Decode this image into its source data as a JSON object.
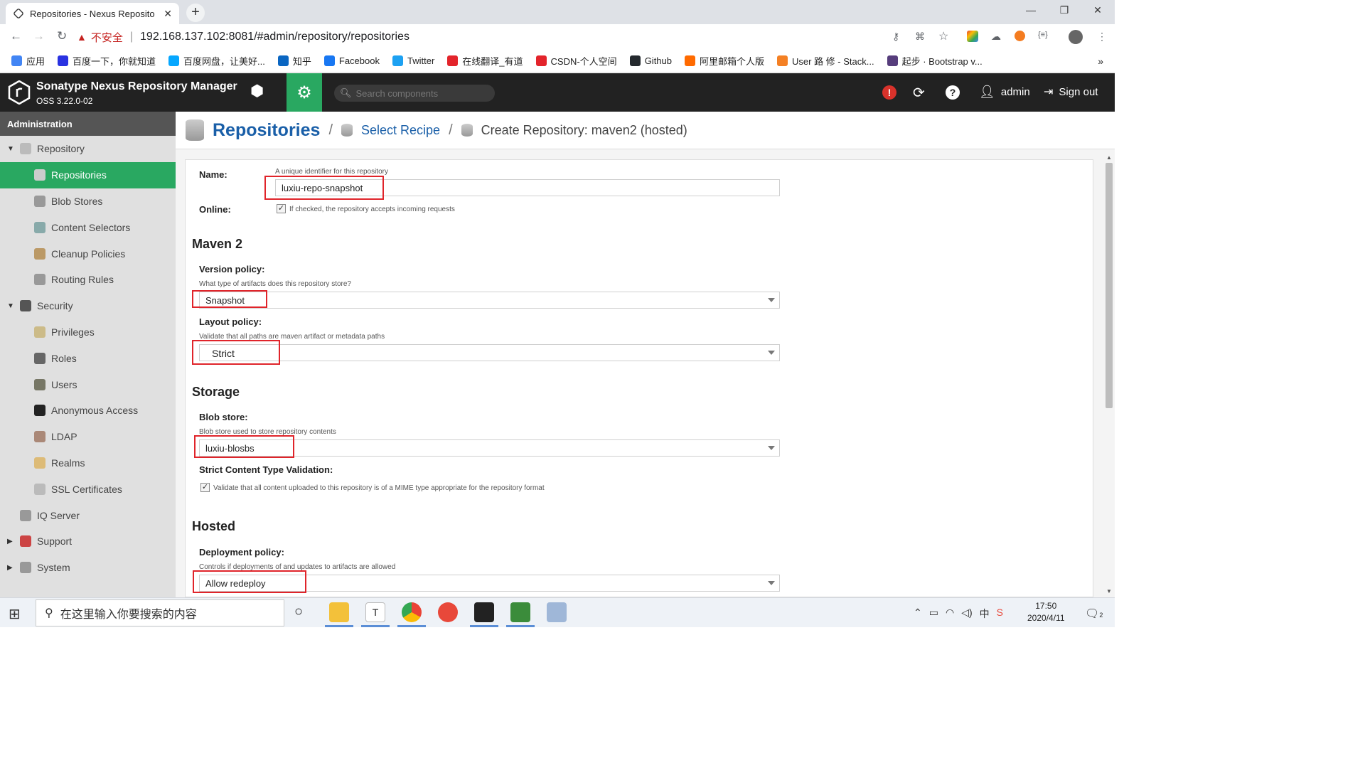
{
  "browser": {
    "tab_title": "Repositories - Nexus Reposito",
    "insecure_label": "不安全",
    "url": "192.168.137.102:8081/#admin/repository/repositories"
  },
  "bookmarks": [
    {
      "label": "应用",
      "color": "#4285f4"
    },
    {
      "label": "百度一下，你就知道",
      "color": "#2932e1"
    },
    {
      "label": "百度网盘，让美好...",
      "color": "#06a7ff"
    },
    {
      "label": "知乎",
      "color": "#0a66c2"
    },
    {
      "label": "Facebook",
      "color": "#1877f2"
    },
    {
      "label": "Twitter",
      "color": "#1da1f2"
    },
    {
      "label": "在线翻译_有道",
      "color": "#e3242b"
    },
    {
      "label": "CSDN-个人空间",
      "color": "#e3242b"
    },
    {
      "label": "Github",
      "color": "#24292e"
    },
    {
      "label": "阿里邮箱个人版",
      "color": "#ff6a00"
    },
    {
      "label": "User 路 修 - Stack...",
      "color": "#f48024"
    },
    {
      "label": "起步 · Bootstrap v...",
      "color": "#563d7c"
    }
  ],
  "header": {
    "app_name": "Sonatype Nexus Repository Manager",
    "version": "OSS 3.22.0-02",
    "search_placeholder": "Search components",
    "user": "admin",
    "signout": "Sign out",
    "alert_mark": "!"
  },
  "sidebar": {
    "title": "Administration",
    "items": [
      {
        "label": "Repository",
        "level": 0,
        "expand": "▼",
        "icon_color": "#bbb"
      },
      {
        "label": "Repositories",
        "level": 1,
        "selected": true,
        "icon_color": "#ccc"
      },
      {
        "label": "Blob Stores",
        "level": 1,
        "icon_color": "#999"
      },
      {
        "label": "Content Selectors",
        "level": 1,
        "icon_color": "#8aa"
      },
      {
        "label": "Cleanup Policies",
        "level": 1,
        "icon_color": "#b96"
      },
      {
        "label": "Routing Rules",
        "level": 1,
        "icon_color": "#999"
      },
      {
        "label": "Security",
        "level": 0,
        "expand": "▼",
        "icon_color": "#555"
      },
      {
        "label": "Privileges",
        "level": 1,
        "icon_color": "#cb8"
      },
      {
        "label": "Roles",
        "level": 1,
        "icon_color": "#666"
      },
      {
        "label": "Users",
        "level": 1,
        "icon_color": "#776"
      },
      {
        "label": "Anonymous Access",
        "level": 1,
        "icon_color": "#222"
      },
      {
        "label": "LDAP",
        "level": 1,
        "icon_color": "#a87"
      },
      {
        "label": "Realms",
        "level": 1,
        "icon_color": "#db7"
      },
      {
        "label": "SSL Certificates",
        "level": 1,
        "icon_color": "#bbb"
      },
      {
        "label": "IQ Server",
        "level": 0,
        "expand": "",
        "icon_color": "#999"
      },
      {
        "label": "Support",
        "level": 0,
        "expand": "▶",
        "icon_color": "#c44"
      },
      {
        "label": "System",
        "level": 0,
        "expand": "▶",
        "icon_color": "#999"
      }
    ]
  },
  "breadcrumb": {
    "main": "Repositories",
    "recipe": "Select Recipe",
    "create": "Create Repository: maven2 (hosted)",
    "separator": "/"
  },
  "form": {
    "name_label": "Name:",
    "name_hint": "A unique identifier for this repository",
    "name_value": "luxiu-repo-snapshot",
    "online_label": "Online:",
    "online_hint": "If checked, the repository accepts incoming requests",
    "maven_section": "Maven 2",
    "version_label": "Version policy:",
    "version_hint": "What type of artifacts does this repository store?",
    "version_value": "Snapshot",
    "layout_label": "Layout policy:",
    "layout_hint": "Validate that all paths are maven artifact or metadata paths",
    "layout_value": "Strict",
    "storage_section": "Storage",
    "blob_label": "Blob store:",
    "blob_hint": "Blob store used to store repository contents",
    "blob_value": "luxiu-blosbs",
    "strict_label": "Strict Content Type Validation:",
    "strict_hint": "Validate that all content uploaded to this repository is of a MIME type appropriate for the repository format",
    "hosted_section": "Hosted",
    "deploy_label": "Deployment policy:",
    "deploy_hint": "Controls if deployments of and updates to artifacts are allowed",
    "deploy_value": "Allow redeploy"
  },
  "taskbar": {
    "search_placeholder": "在这里输入你要搜索的内容",
    "time": "17:50",
    "date": "2020/4/11",
    "ime": "中",
    "notif_count": "2"
  }
}
